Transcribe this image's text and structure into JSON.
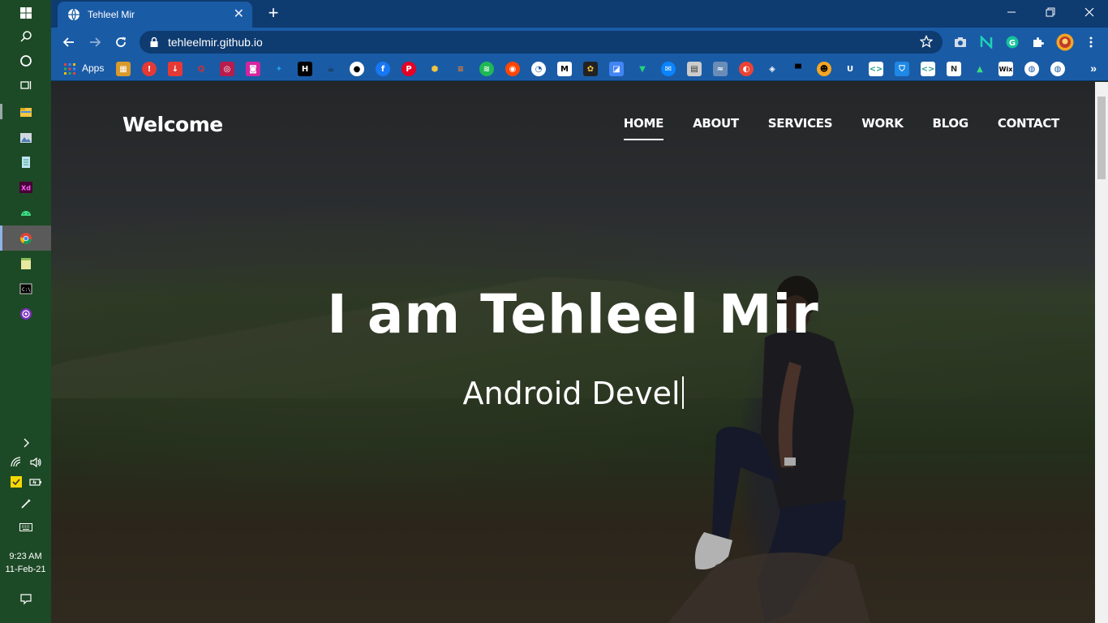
{
  "taskbar": {
    "time": "9:23 AM",
    "date": "11-Feb-21"
  },
  "browser": {
    "tab_title": "Tehleel Mir",
    "url": "tehleelmir.github.io",
    "bookmarks": {
      "apps_label": "Apps"
    }
  },
  "site": {
    "brand": "Welcome",
    "nav": [
      {
        "label": "HOME",
        "active": true
      },
      {
        "label": "ABOUT"
      },
      {
        "label": "SERVICES"
      },
      {
        "label": "WORK"
      },
      {
        "label": "BLOG"
      },
      {
        "label": "CONTACT"
      }
    ],
    "hero_title": "I am Tehleel Mir",
    "hero_subtitle": "Android Devel"
  }
}
